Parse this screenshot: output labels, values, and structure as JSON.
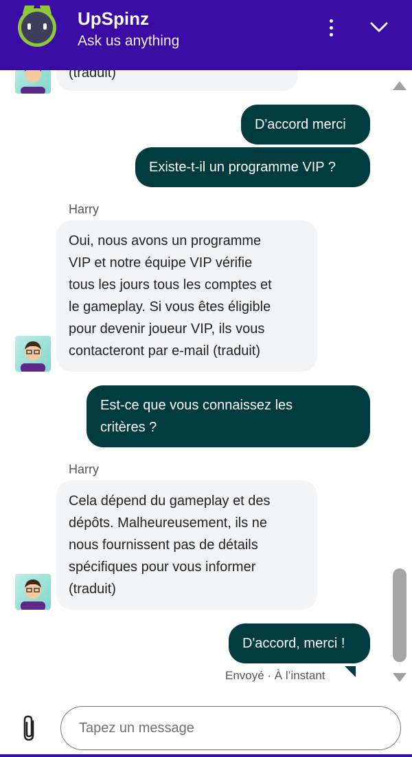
{
  "header": {
    "brand": "UpSpinz",
    "tagline": "Ask us anything"
  },
  "messages": [
    {
      "id": "m0",
      "from": "agent",
      "text": "(traduit)"
    },
    {
      "id": "m1",
      "from": "user",
      "text": "D'accord merci"
    },
    {
      "id": "m2",
      "from": "user",
      "text": "Existe-t-il un programme VIP ?"
    },
    {
      "id": "m3",
      "from": "agent",
      "sender": "Harry",
      "lines": [
        "Oui, nous avons un programme",
        "VIP et notre équipe VIP vérifie",
        "tous les jours tous les comptes et",
        "le gameplay. Si vous êtes éligible",
        "pour devenir joueur VIP, ils vous",
        "contacteront par e-mail (traduit)"
      ]
    },
    {
      "id": "m4",
      "from": "user",
      "lines": [
        "Est-ce que vous connaissez les",
        "critères ?"
      ]
    },
    {
      "id": "m5",
      "from": "agent",
      "sender": "Harry",
      "lines": [
        "Cela dépend du gameplay et des",
        "dépôts. Malheureusement, ils ne",
        "nous fournissent pas de détails",
        "spécifiques pour vous informer",
        "(traduit)"
      ]
    },
    {
      "id": "m6",
      "from": "user",
      "text": "D'accord, merci !"
    }
  ],
  "status": "Envoyé · À l’instant",
  "composer": {
    "placeholder": "Tapez un message"
  },
  "colors": {
    "header": "#3a0ca3",
    "user_bubble": "#003b3f",
    "agent_bubble": "#f3f4f6"
  },
  "icons": [
    "upspinz-logo-icon",
    "more-vertical-icon",
    "chevron-down-icon",
    "paperclip-icon"
  ]
}
